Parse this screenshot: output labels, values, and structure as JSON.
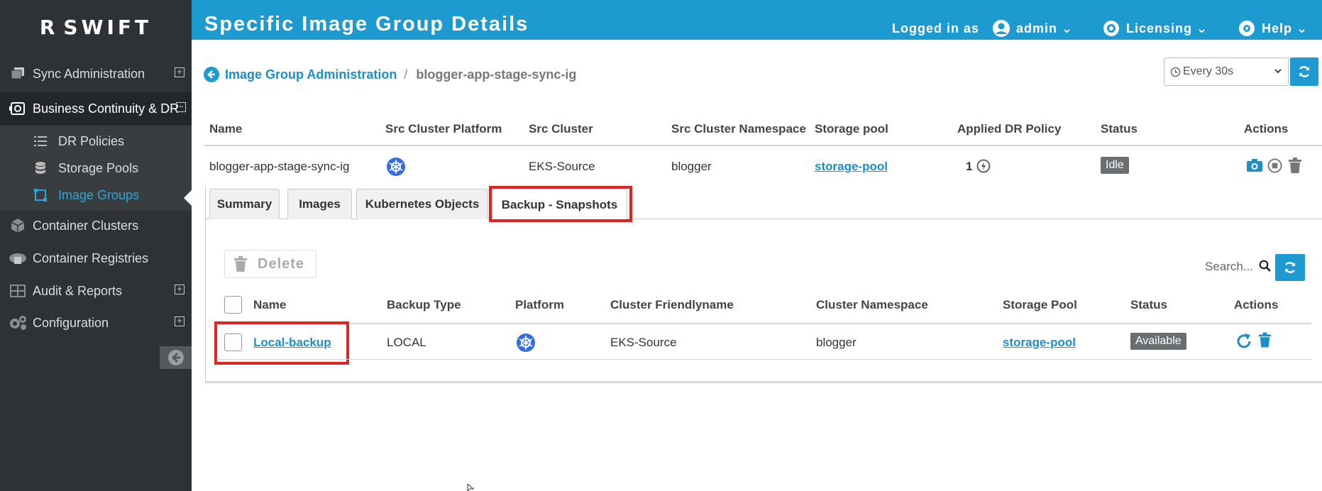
{
  "sidebar": {
    "logo": {
      "mark": "R",
      "text": "SWIFT"
    },
    "items": [
      {
        "label": "Sync Administration",
        "icon": "copy-stack-icon",
        "expand": "+"
      },
      {
        "label": "Business Continuity & DR",
        "icon": "dr-icon",
        "expand": "−"
      },
      {
        "label": "Container Clusters",
        "icon": "cube-icon"
      },
      {
        "label": "Container Registries",
        "icon": "cloud-server-icon"
      },
      {
        "label": "Audit & Reports",
        "icon": "grid-icon",
        "expand": "+"
      },
      {
        "label": "Configuration",
        "icon": "gears-icon",
        "expand": "+"
      }
    ],
    "sub_items": [
      {
        "label": "DR Policies",
        "icon": "list-icon"
      },
      {
        "label": "Storage Pools",
        "icon": "database-icon"
      },
      {
        "label": "Image Groups",
        "icon": "image-group-icon",
        "active": true
      }
    ]
  },
  "header": {
    "title": "Specific Image Group Details",
    "logged_in_as": "Logged in as",
    "user": "admin",
    "licensing": "Licensing",
    "help": "Help"
  },
  "breadcrumb": {
    "parent": "Image Group Administration",
    "separator": "/",
    "current": "blogger-app-stage-sync-ig"
  },
  "refresh": {
    "interval": "Every 30s"
  },
  "group_table": {
    "headers": [
      "Name",
      "Src Cluster Platform",
      "Src Cluster",
      "Src Cluster Namespace",
      "Storage pool",
      "Applied DR Policy",
      "Status",
      "Actions"
    ],
    "row": {
      "name": "blogger-app-stage-sync-ig",
      "platform_icon": "kubernetes-icon",
      "src_cluster": "EKS-Source",
      "namespace": "blogger",
      "storage_pool": "storage-pool",
      "dr_policy_count": "1",
      "status": "Idle"
    }
  },
  "tabs": [
    "Summary",
    "Images",
    "Kubernetes Objects",
    "Backup - Snapshots"
  ],
  "active_tab": "Backup - Snapshots",
  "backup_table": {
    "delete_label": "Delete",
    "search_placeholder": "Search...",
    "headers": [
      "Name",
      "Backup Type",
      "Platform",
      "Cluster Friendlyname",
      "Cluster Namespace",
      "Storage Pool",
      "Status",
      "Actions"
    ],
    "rows": [
      {
        "name": "Local-backup",
        "type": "LOCAL",
        "platform_icon": "kubernetes-icon",
        "cluster": "EKS-Source",
        "namespace": "blogger",
        "storage_pool": "storage-pool",
        "status": "Available"
      }
    ]
  },
  "colors": {
    "header_bg": "#1d9bd0",
    "sidebar_bg": "#2f3235",
    "link": "#1d8fc7",
    "highlight": "#e02424",
    "badge": "#6b6e70"
  }
}
